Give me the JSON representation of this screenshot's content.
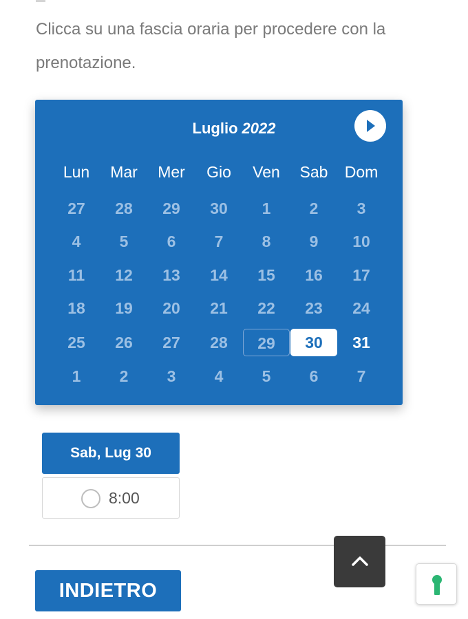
{
  "intro": {
    "line1": "Clicca su una fascia oraria per procedere con la",
    "line2": "prenotazione."
  },
  "calendar": {
    "month": "Luglio",
    "year": "2022",
    "next_icon": "chevron-right-icon",
    "weekdays": [
      "Lun",
      "Mar",
      "Mer",
      "Gio",
      "Ven",
      "Sab",
      "Dom"
    ],
    "weeks": [
      [
        "27",
        "28",
        "29",
        "30",
        "1",
        "2",
        "3"
      ],
      [
        "4",
        "5",
        "6",
        "7",
        "8",
        "9",
        "10"
      ],
      [
        "11",
        "12",
        "13",
        "14",
        "15",
        "16",
        "17"
      ],
      [
        "18",
        "19",
        "20",
        "21",
        "22",
        "23",
        "24"
      ],
      [
        "25",
        "26",
        "27",
        "28",
        "29",
        "30",
        "31"
      ],
      [
        "1",
        "2",
        "3",
        "4",
        "5",
        "6",
        "7"
      ]
    ],
    "today": "29",
    "selected": "30",
    "available": [
      "31"
    ],
    "colors": {
      "background": "#1d6fba",
      "muted_day": "#9cc0e4",
      "selected_bg": "#ffffff"
    }
  },
  "slots": {
    "date_label": "Sab, Lug 30",
    "times": [
      "8:00"
    ]
  },
  "actions": {
    "back_label": "INDIETRO",
    "scroll_top_icon": "chevron-up-icon",
    "accessibility_icon": "keyhole-icon"
  }
}
